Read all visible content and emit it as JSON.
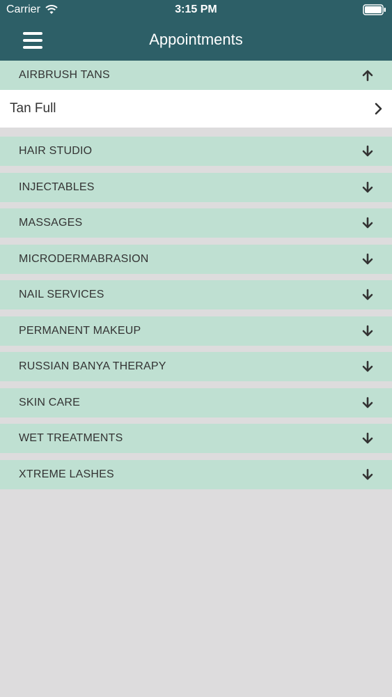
{
  "status_bar": {
    "carrier": "Carrier",
    "time": "3:15 PM"
  },
  "nav": {
    "title": "Appointments"
  },
  "categories": [
    {
      "label": "AIRBRUSH TANS",
      "expanded": true,
      "items": [
        "Tan Full"
      ]
    },
    {
      "label": "HAIR STUDIO",
      "expanded": false
    },
    {
      "label": "INJECTABLES",
      "expanded": false
    },
    {
      "label": "MASSAGES",
      "expanded": false
    },
    {
      "label": "MICRODERMABRASION",
      "expanded": false
    },
    {
      "label": "NAIL SERVICES",
      "expanded": false
    },
    {
      "label": "PERMANENT MAKEUP",
      "expanded": false
    },
    {
      "label": "RUSSIAN BANYA THERAPY",
      "expanded": false
    },
    {
      "label": "SKIN CARE",
      "expanded": false
    },
    {
      "label": "WET TREATMENTS",
      "expanded": false
    },
    {
      "label": "XTREME LASHES",
      "expanded": false
    }
  ],
  "colors": {
    "header": "#2d5f67",
    "category_bg": "#bfe0d2",
    "page_bg": "#dddcdd"
  }
}
